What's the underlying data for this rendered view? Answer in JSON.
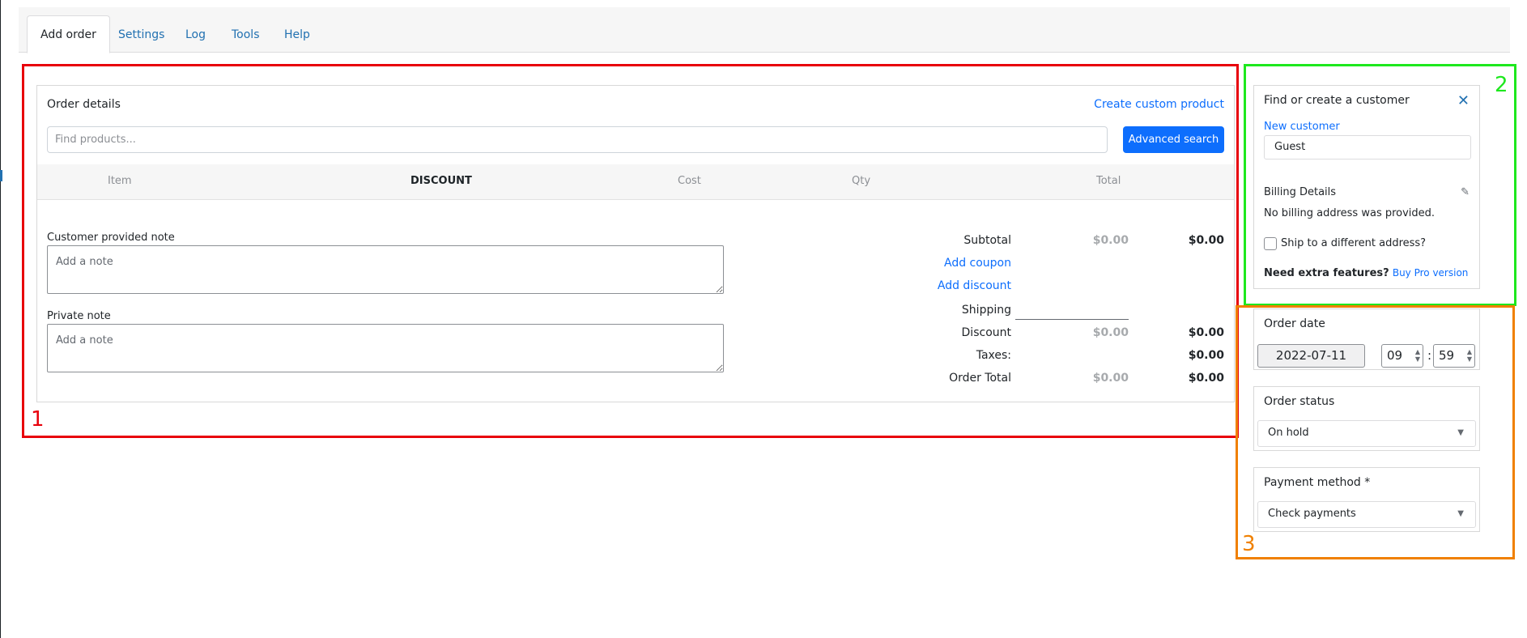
{
  "tabs": [
    "Add order",
    "Settings",
    "Log",
    "Tools",
    "Help"
  ],
  "order": {
    "title": "Order details",
    "create_custom": "Create custom product",
    "search_placeholder": "Find products...",
    "advanced_search": "Advanced search",
    "columns": [
      "Item",
      "DISCOUNT",
      "Cost",
      "Qty",
      "Total"
    ],
    "customer_note_label": "Customer provided note",
    "private_note_label": "Private note",
    "note_placeholder": "Add a note",
    "totals": {
      "subtotal_label": "Subtotal",
      "subtotal_cost": "$0.00",
      "subtotal_total": "$0.00",
      "add_coupon": "Add coupon",
      "add_discount": "Add discount",
      "shipping_label": "Shipping",
      "discount_label": "Discount",
      "discount_cost": "$0.00",
      "discount_total": "$0.00",
      "taxes_label": "Taxes:",
      "taxes_total": "$0.00",
      "order_total_label": "Order Total",
      "order_total_cost": "$0.00",
      "order_total_total": "$0.00"
    }
  },
  "customer": {
    "title": "Find or create a customer",
    "new_customer": "New customer",
    "guest": "Guest",
    "billing_title": "Billing Details",
    "no_billing": "No billing address was provided.",
    "ship_different": "Ship to a different address?",
    "extra_features": "Need extra features?",
    "buy_pro": "Buy Pro version"
  },
  "order_date": {
    "label": "Order date",
    "date": "2022-07-11",
    "hour": "09",
    "minute": "59",
    "separator": ":"
  },
  "order_status": {
    "label": "Order status",
    "value": "On hold"
  },
  "payment": {
    "label": "Payment method *",
    "value": "Check payments"
  },
  "annotations": [
    "1",
    "2",
    "3"
  ],
  "colors": {
    "region1": "#e8000b",
    "region2": "#1ee81e",
    "region3": "#f08000",
    "primary": "#0d6efd"
  }
}
